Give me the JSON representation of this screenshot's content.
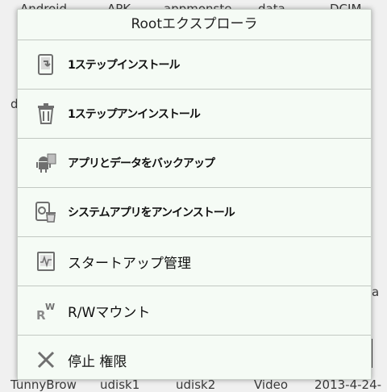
{
  "background": {
    "top_row": [
      "Android",
      "APK",
      "appmonste",
      "data",
      "DCIM"
    ],
    "bottom_row": [
      "TunnyBrow",
      "udisk1",
      "udisk2",
      "Video",
      "2013-4-24-"
    ],
    "side_left": "d",
    "side_right": "a"
  },
  "dialog": {
    "title": "Rootエクスプローラ",
    "items": [
      {
        "label": "1ステップインストール",
        "icon": "install-icon"
      },
      {
        "label": "1ステップアンインストール",
        "icon": "trash-icon"
      },
      {
        "label": "アプリとデータをバックアップ",
        "icon": "android-backup-icon"
      },
      {
        "label": "システムアプリをアンインストール",
        "icon": "system-app-uninstall-icon"
      },
      {
        "label": "スタートアップ管理",
        "icon": "startup-monitor-icon"
      },
      {
        "label": "R/Wマウント",
        "icon": "rw-mount-icon"
      },
      {
        "label": "停止 権限",
        "icon": "stop-icon"
      }
    ]
  },
  "colors": {
    "dialog_bg": "#f5fbf5",
    "divider": "#c2c8c2",
    "icon_gray": "#6f6f6f"
  }
}
